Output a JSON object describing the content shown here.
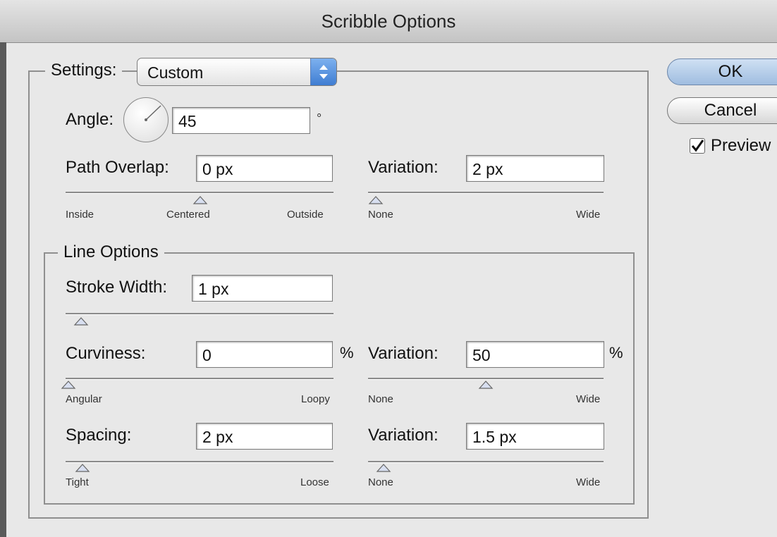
{
  "window": {
    "title": "Scribble Options"
  },
  "settings": {
    "label": "Settings:",
    "selected": "Custom"
  },
  "angle": {
    "label": "Angle:",
    "value": "45",
    "unit": "°"
  },
  "path_overlap": {
    "label": "Path Overlap:",
    "value": "0 px",
    "slider": {
      "min_label": "Inside",
      "mid_label": "Centered",
      "max_label": "Outside"
    }
  },
  "path_overlap_variation": {
    "label": "Variation:",
    "value": "2 px",
    "slider": {
      "min_label": "None",
      "max_label": "Wide"
    }
  },
  "line_options": {
    "title": "Line Options",
    "stroke_width": {
      "label": "Stroke Width:",
      "value": "1 px"
    },
    "curviness": {
      "label": "Curviness:",
      "value": "0",
      "unit": "%",
      "slider": {
        "min_label": "Angular",
        "max_label": "Loopy"
      }
    },
    "curviness_variation": {
      "label": "Variation:",
      "value": "50",
      "unit": "%",
      "slider": {
        "min_label": "None",
        "max_label": "Wide"
      }
    },
    "spacing": {
      "label": "Spacing:",
      "value": "2 px",
      "slider": {
        "min_label": "Tight",
        "max_label": "Loose"
      }
    },
    "spacing_variation": {
      "label": "Variation:",
      "value": "1.5 px",
      "slider": {
        "min_label": "None",
        "max_label": "Wide"
      }
    }
  },
  "buttons": {
    "ok": "OK",
    "cancel": "Cancel"
  },
  "preview": {
    "label": "Preview",
    "checked": true
  }
}
